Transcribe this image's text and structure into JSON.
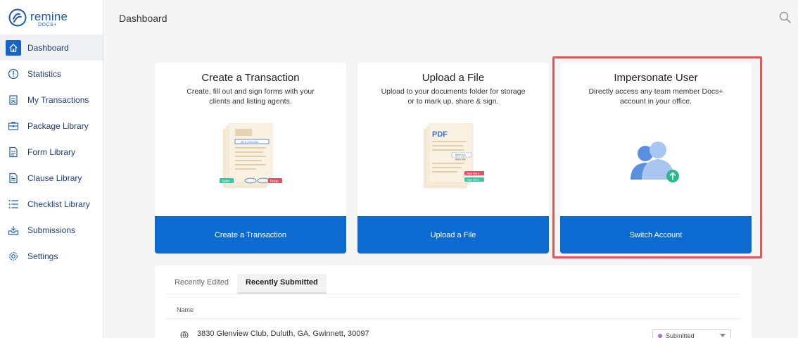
{
  "brand": {
    "name": "remine",
    "sub": "DOCS+"
  },
  "sidebar": {
    "items": [
      {
        "label": "Dashboard",
        "icon": "home-icon",
        "active": true
      },
      {
        "label": "Statistics",
        "icon": "info-circle-icon"
      },
      {
        "label": "My Transactions",
        "icon": "transactions-icon"
      },
      {
        "label": "Package Library",
        "icon": "package-icon"
      },
      {
        "label": "Form Library",
        "icon": "form-icon"
      },
      {
        "label": "Clause Library",
        "icon": "clause-icon"
      },
      {
        "label": "Checklist Library",
        "icon": "checklist-icon"
      },
      {
        "label": "Submissions",
        "icon": "submissions-icon"
      },
      {
        "label": "Settings",
        "icon": "gear-icon"
      }
    ]
  },
  "header": {
    "title": "Dashboard",
    "search_icon": "search-icon"
  },
  "cards": [
    {
      "title": "Create a Transaction",
      "description": "Create, fill out and sign forms with your clients and listing agents.",
      "button": "Create a Transaction",
      "illus": {
        "field": "MLS #312345",
        "seller": "Seller",
        "buyer": "Buyer"
      }
    },
    {
      "title": "Upload a File",
      "description": "Upload to your documents folder for storage or to mark up, share & sign.",
      "button": "Upload a File",
      "illus": {
        "pdf": "PDF",
        "amount1": "$500,000",
        "amount2": "$400,000",
        "sign1": "Sign Here",
        "sign2": "Sign Here"
      }
    },
    {
      "title": "Impersonate User",
      "description": "Directly access any team member Docs+ account in your office.",
      "button": "Switch Account"
    }
  ],
  "recent": {
    "tabs": [
      "Recently Edited",
      "Recently Submitted"
    ],
    "active_tab": 1,
    "column": "Name",
    "rows": [
      {
        "name": "3830 Glenview Club, Duluth, GA, Gwinnett, 30097",
        "status": "Submitted"
      }
    ]
  },
  "colors": {
    "accent": "#0b6bd1",
    "brand": "#1e5bb0",
    "highlight": "#e05a5a",
    "status_dot": "#a86fd4"
  }
}
